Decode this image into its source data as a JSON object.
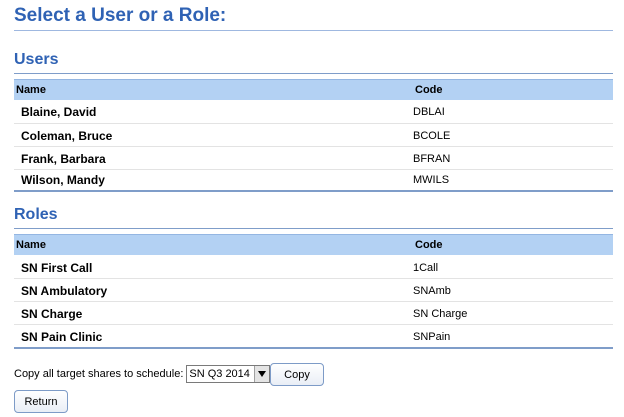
{
  "page": {
    "title": "Select a User or a Role:"
  },
  "users": {
    "section_title": "Users",
    "columns": {
      "name": "Name",
      "code": "Code"
    },
    "rows": [
      {
        "name": "Blaine, David",
        "code": "DBLAI"
      },
      {
        "name": "Coleman, Bruce",
        "code": "BCOLE"
      },
      {
        "name": "Frank, Barbara",
        "code": "BFRAN"
      },
      {
        "name": "Wilson, Mandy",
        "code": "MWILS"
      }
    ]
  },
  "roles": {
    "section_title": "Roles",
    "columns": {
      "name": "Name",
      "code": "Code"
    },
    "rows": [
      {
        "name": "SN First Call",
        "code": "1Call"
      },
      {
        "name": "SN Ambulatory",
        "code": "SNAmb"
      },
      {
        "name": "SN Charge",
        "code": "SN Charge"
      },
      {
        "name": "SN Pain Clinic",
        "code": "SNPain"
      }
    ]
  },
  "copy": {
    "label": "Copy all target shares to schedule:",
    "selected_schedule": "SN Q3 2014",
    "button_label": "Copy"
  },
  "return_button_label": "Return",
  "colors": {
    "accent": "#2f62b4",
    "header_bg": "#b3d1f3"
  }
}
